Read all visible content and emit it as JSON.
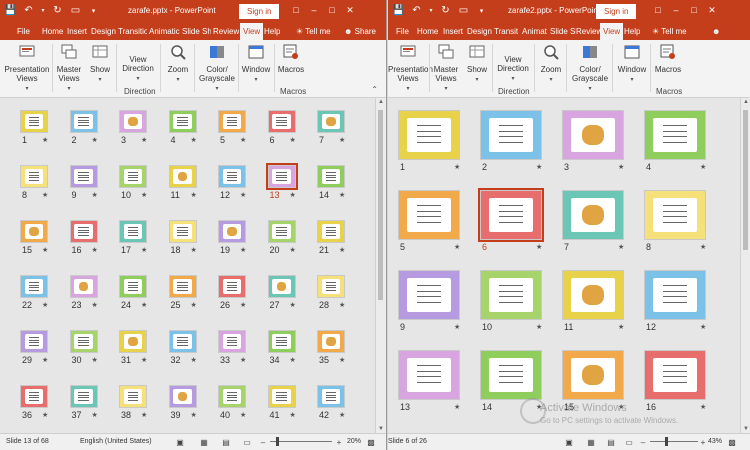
{
  "windows": [
    {
      "id": "win1",
      "title": "zarafe.pptx - PowerPoint",
      "signin": "Sign in",
      "tabs": [
        "File",
        "Home",
        "Insert",
        "Design",
        "Transitio",
        "Animatic",
        "Slide Sho",
        "Review",
        "View",
        "Help",
        "Tell me",
        "Share"
      ],
      "active_tab": "View",
      "ribbon": {
        "presentation_views": "Presentation Views",
        "master_views": "Master Views",
        "show": "Show",
        "view_direction": "View Direction",
        "direction_group": "Direction",
        "zoom": "Zoom",
        "color_grayscale": "Color/ Grayscale",
        "window": "Window",
        "macros": "Macros",
        "macros_group": "Macros"
      },
      "slides": [
        "1",
        "2",
        "3",
        "4",
        "5",
        "6",
        "7",
        "8",
        "9",
        "10",
        "11",
        "12",
        "13",
        "14",
        "15",
        "16",
        "17",
        "18",
        "19",
        "20",
        "21",
        "22",
        "23",
        "24",
        "25",
        "26",
        "27",
        "28",
        "29",
        "30",
        "31",
        "32",
        "33",
        "34",
        "35",
        "36",
        "37",
        "38",
        "39",
        "40",
        "41",
        "42"
      ],
      "selected_slide": "13",
      "star": "★",
      "status": {
        "slide": "Slide 13 of 68",
        "language": "English (United States)",
        "zoom": "20%"
      }
    },
    {
      "id": "win2",
      "title": "zarafe2.pptx - PowerPoint",
      "signin": "Sign in",
      "tabs": [
        "File",
        "Home",
        "Insert",
        "Design",
        "Transit",
        "Animat",
        "Slide Sl",
        "Review",
        "View",
        "Help",
        "Tell me"
      ],
      "active_tab": "View",
      "ribbon": {
        "presentation_views": "Presentation Views",
        "master_views": "Master Views",
        "show": "Show",
        "view_direction": "View Direction",
        "direction_group": "Direction",
        "zoom": "Zoom",
        "color_grayscale": "Color/ Grayscale",
        "window": "Window",
        "macros": "Macros",
        "macros_group": "Macros"
      },
      "slides": [
        "1",
        "2",
        "3",
        "4",
        "5",
        "6",
        "7",
        "8",
        "9",
        "10",
        "11",
        "12",
        "13",
        "14",
        "15",
        "16"
      ],
      "selected_slide": "6",
      "star": "★",
      "status": {
        "slide": "Slide 6 of 26",
        "zoom": "43%"
      }
    }
  ],
  "watermark": {
    "line1": "Activate Windows",
    "line2": "Go to PC settings to activate Windows."
  },
  "colors": {
    "accent": "#c43e1c",
    "selected_number": "#c43e1c"
  }
}
